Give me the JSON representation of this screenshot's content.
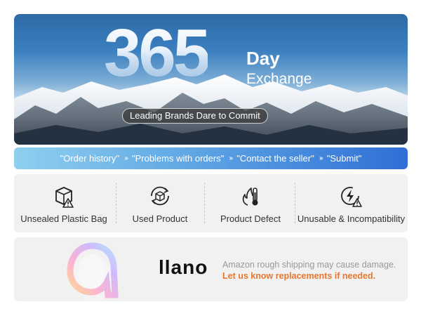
{
  "hero": {
    "number": "365",
    "day": "Day",
    "exchange": "Exchange",
    "tagline": "Leading Brands Dare to Commit"
  },
  "steps": {
    "items": [
      "\"Order history\"",
      "\"Problems with orders\"",
      "\"Contact the seller\"",
      "\"Submit\""
    ],
    "separator": "›››"
  },
  "reasons": {
    "items": [
      {
        "label": "Unsealed Plastic Bag",
        "icon": "box-warning-icon"
      },
      {
        "label": "Used Product",
        "icon": "recycle-box-icon"
      },
      {
        "label": "Product Defect",
        "icon": "fire-thermometer-icon"
      },
      {
        "label": "Unusable & Incompatibility",
        "icon": "lightning-warning-icon"
      }
    ]
  },
  "brand": {
    "logo": "llano",
    "line1": "Amazon rough shipping may cause damage.",
    "line2": "Let us know replacements if needed."
  },
  "colors": {
    "accent_orange": "#e8772e",
    "steps_gradient_start": "#8fd0ef",
    "steps_gradient_end": "#2f6fd6"
  }
}
